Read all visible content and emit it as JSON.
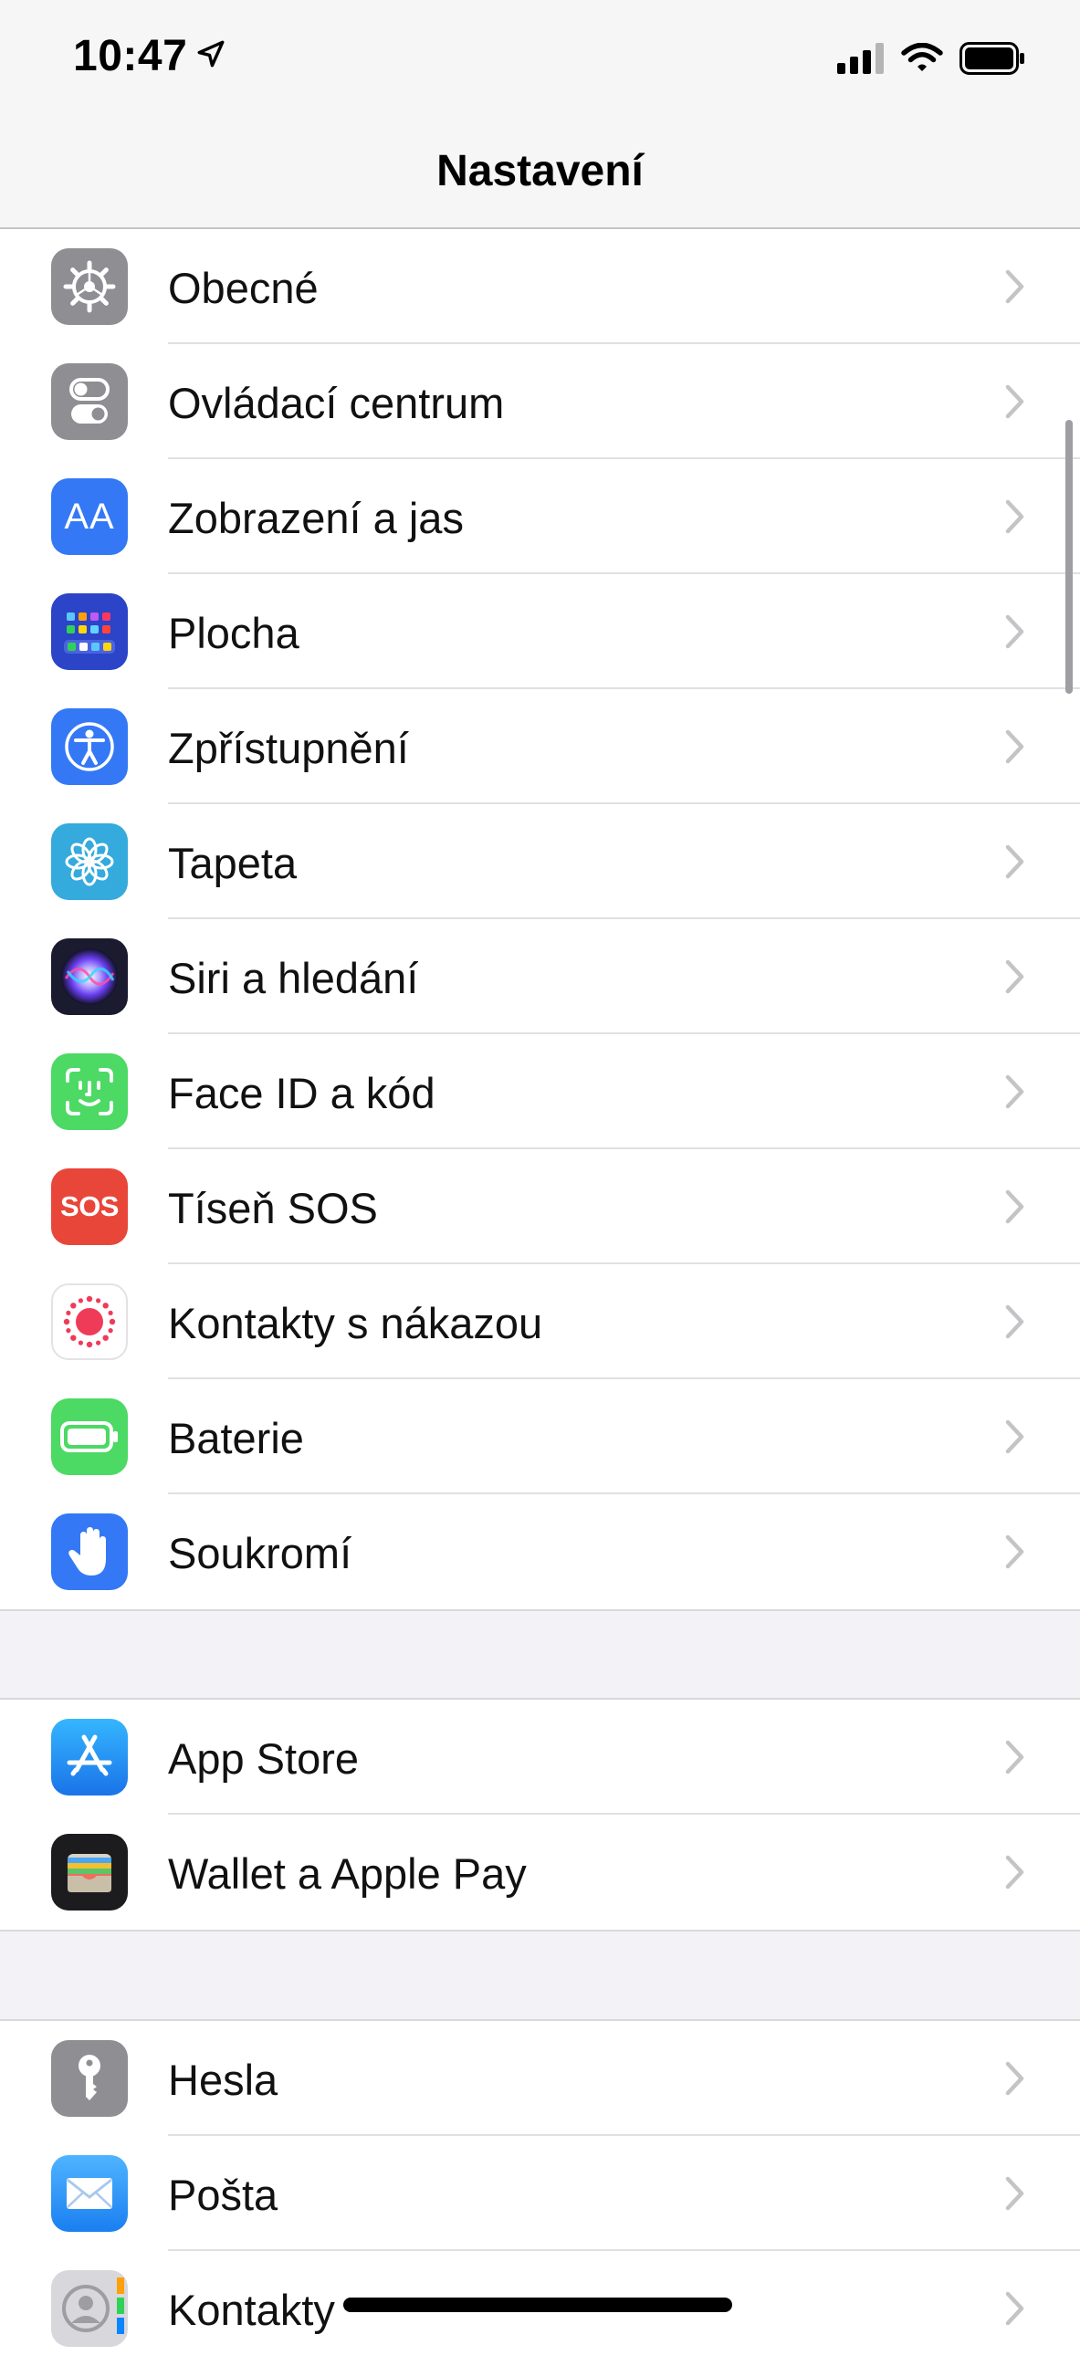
{
  "status_bar": {
    "time": "10:47",
    "icons": [
      "location-arrow-icon",
      "cellular-signal-icon",
      "wifi-icon",
      "battery-icon"
    ]
  },
  "nav": {
    "title": "Nastavení"
  },
  "groups": [
    {
      "items": [
        {
          "label": "Obecné",
          "icon": "gear-icon",
          "color": "#8e8e93"
        },
        {
          "label": "Ovládací centrum",
          "icon": "control-center-toggles-icon",
          "color": "#8e8e93"
        },
        {
          "label": "Zobrazení a jas",
          "icon": "text-size-aa-icon",
          "color": "#3478f6"
        },
        {
          "label": "Plocha",
          "icon": "home-screen-grid-icon",
          "color": "#2b44c8"
        },
        {
          "label": "Zpřístupnění",
          "icon": "accessibility-person-icon",
          "color": "#3478f6"
        },
        {
          "label": "Tapeta",
          "icon": "flower-wallpaper-icon",
          "color": "#35aadc"
        },
        {
          "label": "Siri a hledání",
          "icon": "siri-orb-icon",
          "color": "#1b1b2f"
        },
        {
          "label": "Face ID a kód",
          "icon": "face-id-icon",
          "color": "#4cd964"
        },
        {
          "label": "Tíseň SOS",
          "icon": "sos-icon",
          "color": "#e9463a"
        },
        {
          "label": "Kontakty s nákazou",
          "icon": "exposure-notification-icon",
          "color": "#ffffff"
        },
        {
          "label": "Baterie",
          "icon": "battery-app-icon",
          "color": "#4cd964"
        },
        {
          "label": "Soukromí",
          "icon": "privacy-hand-icon",
          "color": "#3478f6"
        }
      ]
    },
    {
      "items": [
        {
          "label": "App Store",
          "icon": "app-store-icon",
          "color": "#1e8ef5"
        },
        {
          "label": "Wallet a Apple Pay",
          "icon": "wallet-icon",
          "color": "#1c1c1e"
        }
      ]
    },
    {
      "items": [
        {
          "label": "Hesla",
          "icon": "key-icon",
          "color": "#8e8e93"
        },
        {
          "label": "Pošta",
          "icon": "mail-envelope-icon",
          "color": "#2f9bf0"
        },
        {
          "label": "Kontakty",
          "icon": "contacts-person-icon",
          "color": "#cfcfd4"
        }
      ]
    }
  ],
  "sos_icon_text": "SOS",
  "aa_icon_text": "AA"
}
